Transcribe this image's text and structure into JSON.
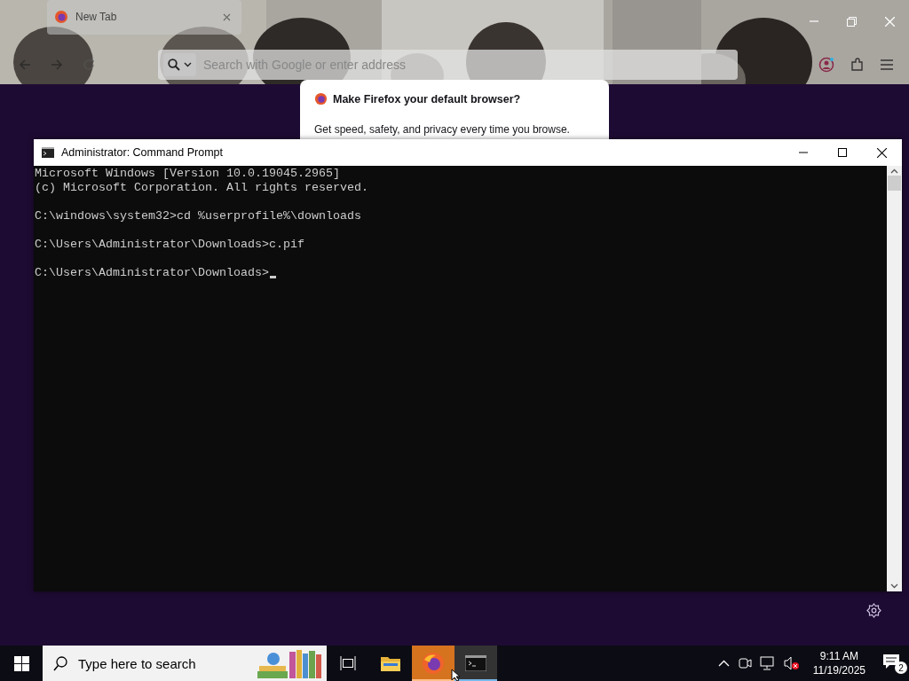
{
  "browser": {
    "tab": {
      "title": "New Tab"
    },
    "address_bar": {
      "placeholder": "Search with Google or enter address"
    },
    "popup": {
      "title": "Make Firefox your default browser?",
      "body": "Get speed, safety, and privacy every time you browse."
    }
  },
  "console": {
    "title": "Administrator: Command Prompt",
    "blocks": [
      [
        "Microsoft Windows [Version 10.0.19045.2965]",
        "(c) Microsoft Corporation. All rights reserved."
      ],
      [
        "C:\\windows\\system32>cd %userprofile%\\downloads"
      ],
      [
        "C:\\Users\\Administrator\\Downloads>c.pif"
      ],
      [
        "C:\\Users\\Administrator\\Downloads>"
      ]
    ]
  },
  "taskbar": {
    "search": {
      "placeholder": "Type here to search"
    },
    "apps": [
      {
        "kind": "files",
        "selected": false,
        "open": false
      },
      {
        "kind": "browser",
        "selected": true,
        "open": true
      },
      {
        "kind": "terminal",
        "selected": false,
        "open": true
      }
    ],
    "time": "9:11 AM",
    "date": "11/19/2025",
    "notifications": "2"
  }
}
